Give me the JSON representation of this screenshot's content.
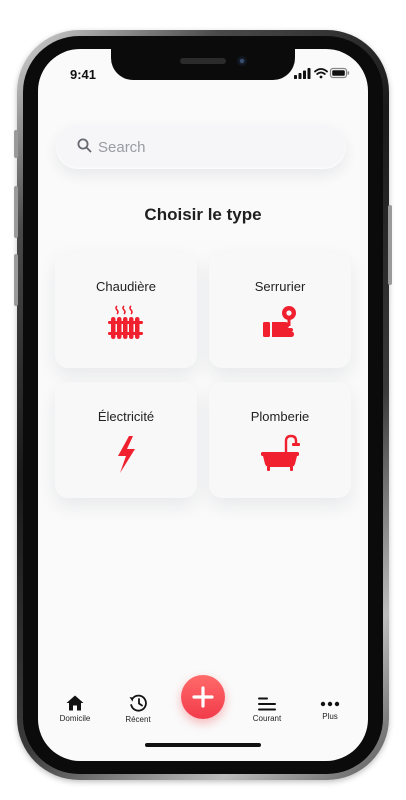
{
  "status": {
    "time": "9:41"
  },
  "search": {
    "placeholder": "Search"
  },
  "title": "Choisir le type",
  "types": [
    {
      "label": "Chaudière",
      "icon": "radiator-icon"
    },
    {
      "label": "Serrurier",
      "icon": "locksmith-key-hand-icon"
    },
    {
      "label": "Électricité",
      "icon": "lightning-bolt-icon"
    },
    {
      "label": "Plomberie",
      "icon": "bathtub-faucet-icon"
    }
  ],
  "nav": {
    "home": "Domicile",
    "recent": "Récent",
    "add": "add-icon",
    "current": "Courant",
    "more": "Plus"
  },
  "colors": {
    "accent": "#f0202f",
    "fab": "#f23b4b",
    "background": "#fafafa"
  }
}
